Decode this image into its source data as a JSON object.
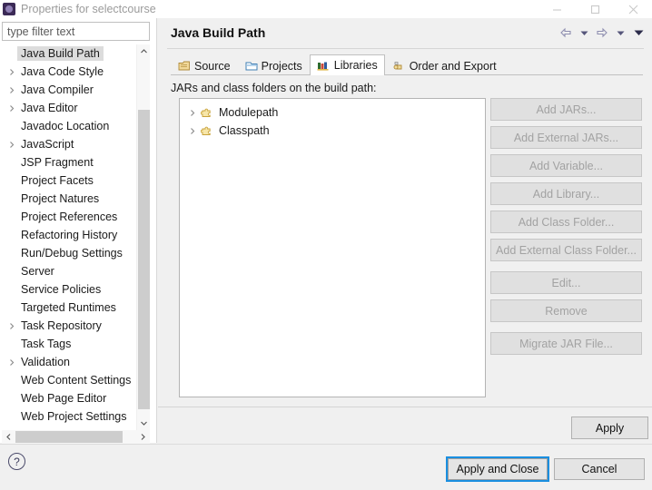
{
  "window": {
    "title": "Properties for selectcourse",
    "icon": "eclipse-icon",
    "controls": {
      "minimize": "minimize-icon",
      "maximize": "maximize-icon",
      "close": "close-icon"
    }
  },
  "sidebar": {
    "filter": {
      "placeholder": "type filter text",
      "value": ""
    },
    "items": [
      {
        "label": "Java Build Path",
        "expandable": false,
        "selected": true
      },
      {
        "label": "Java Code Style",
        "expandable": true,
        "selected": false
      },
      {
        "label": "Java Compiler",
        "expandable": true,
        "selected": false
      },
      {
        "label": "Java Editor",
        "expandable": true,
        "selected": false
      },
      {
        "label": "Javadoc Location",
        "expandable": false,
        "selected": false
      },
      {
        "label": "JavaScript",
        "expandable": true,
        "selected": false
      },
      {
        "label": "JSP Fragment",
        "expandable": false,
        "selected": false
      },
      {
        "label": "Project Facets",
        "expandable": false,
        "selected": false
      },
      {
        "label": "Project Natures",
        "expandable": false,
        "selected": false
      },
      {
        "label": "Project References",
        "expandable": false,
        "selected": false
      },
      {
        "label": "Refactoring History",
        "expandable": false,
        "selected": false
      },
      {
        "label": "Run/Debug Settings",
        "expandable": false,
        "selected": false
      },
      {
        "label": "Server",
        "expandable": false,
        "selected": false
      },
      {
        "label": "Service Policies",
        "expandable": false,
        "selected": false
      },
      {
        "label": "Targeted Runtimes",
        "expandable": false,
        "selected": false
      },
      {
        "label": "Task Repository",
        "expandable": true,
        "selected": false
      },
      {
        "label": "Task Tags",
        "expandable": false,
        "selected": false
      },
      {
        "label": "Validation",
        "expandable": true,
        "selected": false
      },
      {
        "label": "Web Content Settings",
        "expandable": false,
        "selected": false
      },
      {
        "label": "Web Page Editor",
        "expandable": false,
        "selected": false
      },
      {
        "label": "Web Project Settings",
        "expandable": false,
        "selected": false
      }
    ]
  },
  "page": {
    "title": "Java Build Path",
    "nav": [
      "back-arrow-icon",
      "back-dropdown-icon",
      "forward-arrow-icon",
      "forward-dropdown-icon",
      "view-menu-icon"
    ],
    "tabs": [
      {
        "label": "Source",
        "icon": "source-folder-icon",
        "active": false
      },
      {
        "label": "Projects",
        "icon": "projects-icon",
        "active": false
      },
      {
        "label": "Libraries",
        "icon": "libraries-icon",
        "active": true
      },
      {
        "label": "Order and Export",
        "icon": "order-export-icon",
        "active": false
      }
    ],
    "tree_label": "JARs and class folders on the build path:",
    "tree_items": [
      {
        "label": "Modulepath",
        "icon": "puzzle-icon",
        "expandable": true
      },
      {
        "label": "Classpath",
        "icon": "puzzle-icon",
        "expandable": true
      }
    ],
    "buttons": [
      {
        "label": "Add JARs...",
        "enabled": false,
        "gap": false
      },
      {
        "label": "Add External JARs...",
        "enabled": false,
        "gap": false
      },
      {
        "label": "Add Variable...",
        "enabled": false,
        "gap": false
      },
      {
        "label": "Add Library...",
        "enabled": false,
        "gap": false
      },
      {
        "label": "Add Class Folder...",
        "enabled": false,
        "gap": false
      },
      {
        "label": "Add External Class Folder...",
        "enabled": false,
        "gap": false
      },
      {
        "label": "Edit...",
        "enabled": false,
        "gap": true
      },
      {
        "label": "Remove",
        "enabled": false,
        "gap": false
      },
      {
        "label": "Migrate JAR File...",
        "enabled": false,
        "gap": true
      }
    ],
    "apply_label": "Apply"
  },
  "footer": {
    "help_icon": "help-icon",
    "help_glyph": "?",
    "apply_and_close": "Apply and Close",
    "cancel": "Cancel"
  },
  "colors": {
    "dialog_bg": "#f0f0f0",
    "panel_bg": "#ffffff",
    "selection": "#dcdcdc",
    "focus_ring": "#1a8fe0",
    "button_face": "#e0e0e0",
    "disabled_text": "#a2a2a2",
    "title_text": "#9b9b9b"
  }
}
